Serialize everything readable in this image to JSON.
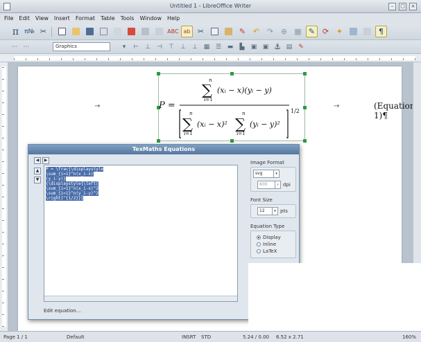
{
  "window": {
    "title": "Untitled 1 - LibreOffice Writer"
  },
  "menu": [
    "File",
    "Edit",
    "View",
    "Insert",
    "Format",
    "Table",
    "Tools",
    "Window",
    "Help"
  ],
  "toolbar": {
    "style_value": "Graphics"
  },
  "document": {
    "equation_label": "(Equation 1)",
    "pilcrow": "¶",
    "arrow": "→",
    "formula": {
      "lhs": "P =",
      "num_sum_top": "n",
      "num_sum_bottom": "i=1",
      "numerator": "(xᵢ − x)(yᵢ − y)",
      "den_sum1_top": "n",
      "den_sum1_bottom": "i=1",
      "den_term1": "(xᵢ − x)²",
      "den_sum2_top": "n",
      "den_sum2_bottom": "i=1",
      "den_term2": "(yᵢ − y)²",
      "exponent": "1/2"
    }
  },
  "dialog": {
    "title": "TexMaths Equations",
    "code_lines": [
      "P = \\frac{\\displaystyle",
      "\\sum_{i=1}^n(x_i-x)",
      "(y_i-y)}",
      "{\\displaystyle{\\left[",
      "\\sum_{i=1}^n(x_i-x)^2",
      "\\sum_{i=1}^n(y_i-y)^2",
      "\\right]^{1/2}}}"
    ],
    "edit_link": "Edit equation...",
    "image_format_label": "Image Format",
    "image_format_value": "svg",
    "dpi_value": "600",
    "dpi_label": "dpi",
    "font_size_label": "Font Size",
    "font_size_value": "12",
    "font_size_unit": "pts",
    "equation_type_label": "Equation Type",
    "equation_types": [
      "Display",
      "Inline",
      "LaTeX"
    ],
    "equation_type_selected": "Display"
  },
  "statusbar": {
    "page": "Page 1 / 1",
    "style": "Default",
    "insert_mode": "INSRT",
    "selection_mode": "STD",
    "position": "5.24 / 0.00",
    "size": "6.52 x 2.71",
    "zoom": "160%"
  }
}
